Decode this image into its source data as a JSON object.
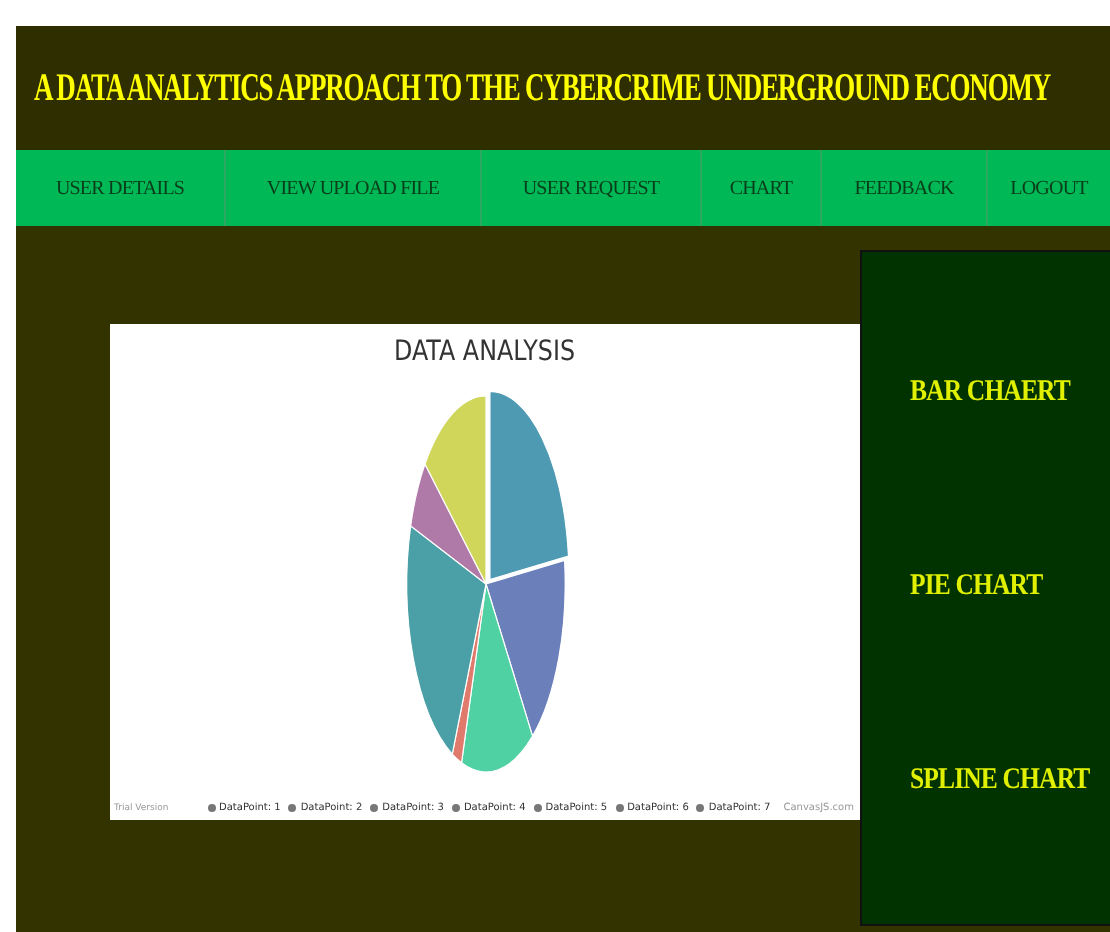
{
  "header": {
    "title": "A DATA ANALYTICS APPROACH TO THE CYBERCRIME UNDERGROUND ECONOMY"
  },
  "nav": [
    {
      "label": "USER DETAILS"
    },
    {
      "label": "VIEW UPLOAD FILE"
    },
    {
      "label": "USER REQUEST"
    },
    {
      "label": "CHART"
    },
    {
      "label": "FEEDBACK"
    },
    {
      "label": "LOGOUT"
    }
  ],
  "chart": {
    "title": "DATA ANALYSIS",
    "trial_note": "Trial Version",
    "credit": "CanvasJS.com",
    "legend": [
      {
        "label": "DataPoint: 1"
      },
      {
        "label": "DataPoint: 2"
      },
      {
        "label": "DataPoint: 3"
      },
      {
        "label": "DataPoint: 4"
      },
      {
        "label": "DataPoint: 5"
      },
      {
        "label": "DataPoint: 6"
      },
      {
        "label": "DataPoint: 7"
      }
    ]
  },
  "side_menu": [
    {
      "label": "BAR CHAERT"
    },
    {
      "label": "PIE CHART"
    },
    {
      "label": "SPLINE CHART"
    }
  ]
}
